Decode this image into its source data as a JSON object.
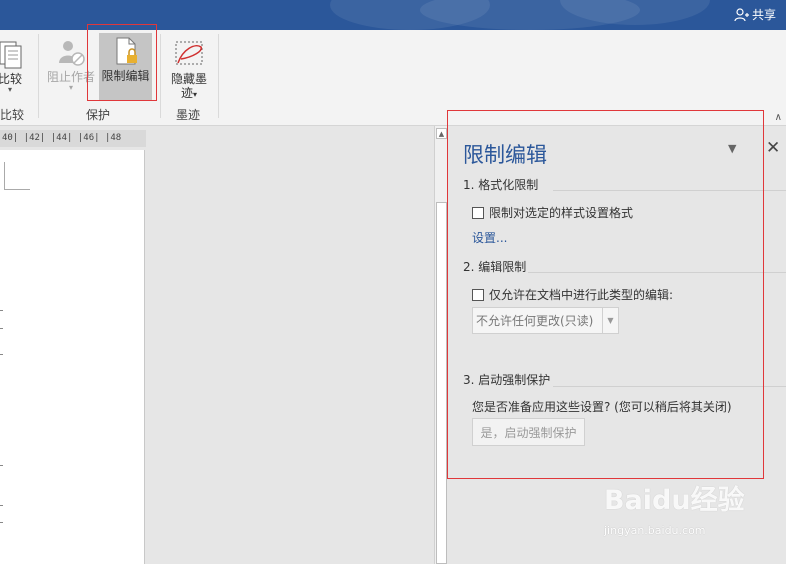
{
  "titlebar": {
    "share_label": "共享"
  },
  "ribbon": {
    "compare_label": "比较",
    "compare_group": "比较",
    "block_authors_label": "阻止作者",
    "restrict_editing_label": "限制编辑",
    "protect_group": "保护",
    "hide_ink_label_1": "隐藏墨",
    "hide_ink_label_2": "迹",
    "ink_group": "墨迹"
  },
  "ruler": {
    "text": "40| |42| |44| |46| |48"
  },
  "pane": {
    "title": "限制编辑",
    "section1": {
      "heading": "1. 格式化限制",
      "checkbox_label": "限制对选定的样式设置格式",
      "settings_link": "设置..."
    },
    "section2": {
      "heading": "2. 编辑限制",
      "checkbox_label": "仅允许在文档中进行此类型的编辑:",
      "dropdown_value": "不允许任何更改(只读)"
    },
    "section3": {
      "heading": "3. 启动强制保护",
      "question": "您是否准备应用这些设置? (您可以稍后将其关闭)",
      "enforce_button": "是，启动强制保护"
    }
  },
  "watermark": {
    "main": "Baidu经验",
    "sub": "jingyan.baidu.com"
  },
  "colors": {
    "brand": "#2b579a",
    "highlight": "#e0373a"
  }
}
